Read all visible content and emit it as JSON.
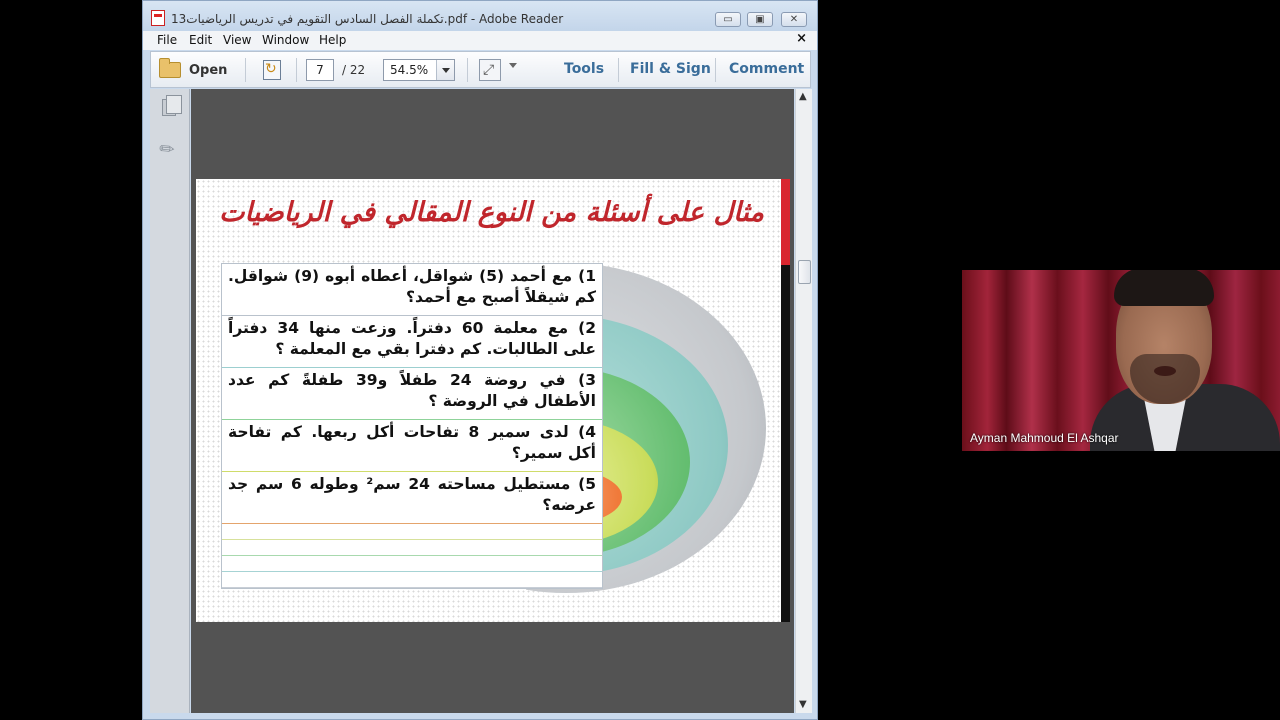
{
  "window": {
    "title": "13تكملة الفصل السادس التقويم في تدريس الرياضيات.pdf - Adobe Reader",
    "minimize": "▭",
    "maximize": "▣",
    "close": "✕"
  },
  "menu": {
    "items": [
      "File",
      "Edit",
      "View",
      "Window",
      "Help"
    ],
    "close": "×"
  },
  "toolbar": {
    "open_label": "Open",
    "page_current": "7",
    "page_total": "/ 22",
    "zoom": "54.5%",
    "tools_label": "Tools",
    "fill_sign_label": "Fill & Sign",
    "comment_label": "Comment"
  },
  "slide": {
    "title": "مثال على أسئلة من النوع المقالي في الرياضيات",
    "questions": [
      "1) مع أحمد (5) شواقل، أعطاه أبوه (9) شواقل. كم شيقلاً أصبح مع أحمد؟",
      "2) مع معلمة 60 دفتراً. وزعت منها 34 دفتراً على الطالبات. كم دفترا بقي مع المعلمة ؟",
      "3) في روضة 24 طفلاً و39 طفلةً كم عدد الأطفال في الروضة ؟",
      "4) لدى سمير 8 تفاحات أكل ربعها. كم تفاحة أكل سمير؟",
      "5) مستطيل مساحته 24 سم² وطوله 6 سم جد عرضه؟"
    ]
  },
  "colors": {
    "title_red": "#c0262c",
    "ring_gray": "#c5c8cc",
    "ring_teal": "#8ec9c4",
    "ring_green": "#63bd6f",
    "ring_lime": "#c9dc5a",
    "ring_orange": "#f07a3a"
  },
  "video": {
    "participant_name": "Ayman Mahmoud El Ashqar"
  }
}
